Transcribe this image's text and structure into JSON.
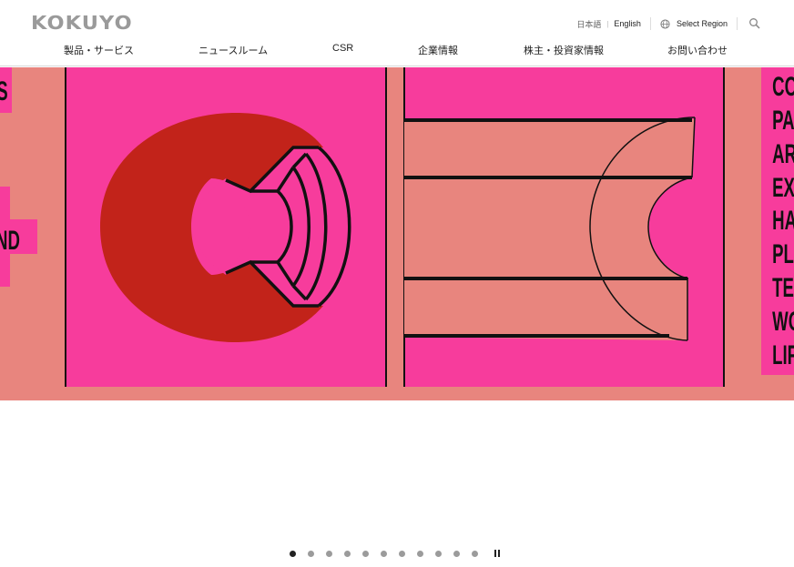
{
  "header": {
    "logo_text": "KOKUYO",
    "utility": {
      "lang_ja": "日本語",
      "lang_separator": "|",
      "lang_en": "English",
      "region_label": "Select Region"
    },
    "nav": [
      {
        "label": "製品・サービス"
      },
      {
        "label": "ニュースルーム"
      },
      {
        "label": "CSR"
      },
      {
        "label": "企業情報"
      },
      {
        "label": "株主・投資家情報"
      },
      {
        "label": "お問い合わせ"
      }
    ]
  },
  "hero": {
    "left_fragments": [
      "S",
      "ND"
    ],
    "right_words": [
      "CO",
      "PA",
      "AR",
      "EX",
      "HA",
      "PL",
      "TE",
      "WO",
      "LIF"
    ]
  },
  "carousel": {
    "slide_count": 11,
    "active_index": 0
  },
  "colors": {
    "hero_background": "#e8857e",
    "panel_pink": "#f73c9c",
    "accent_red": "#c2231a",
    "outline": "#111111",
    "logo_gray": "#9a9a9a"
  },
  "icons": [
    "globe-icon",
    "search-icon",
    "pause-icon"
  ]
}
